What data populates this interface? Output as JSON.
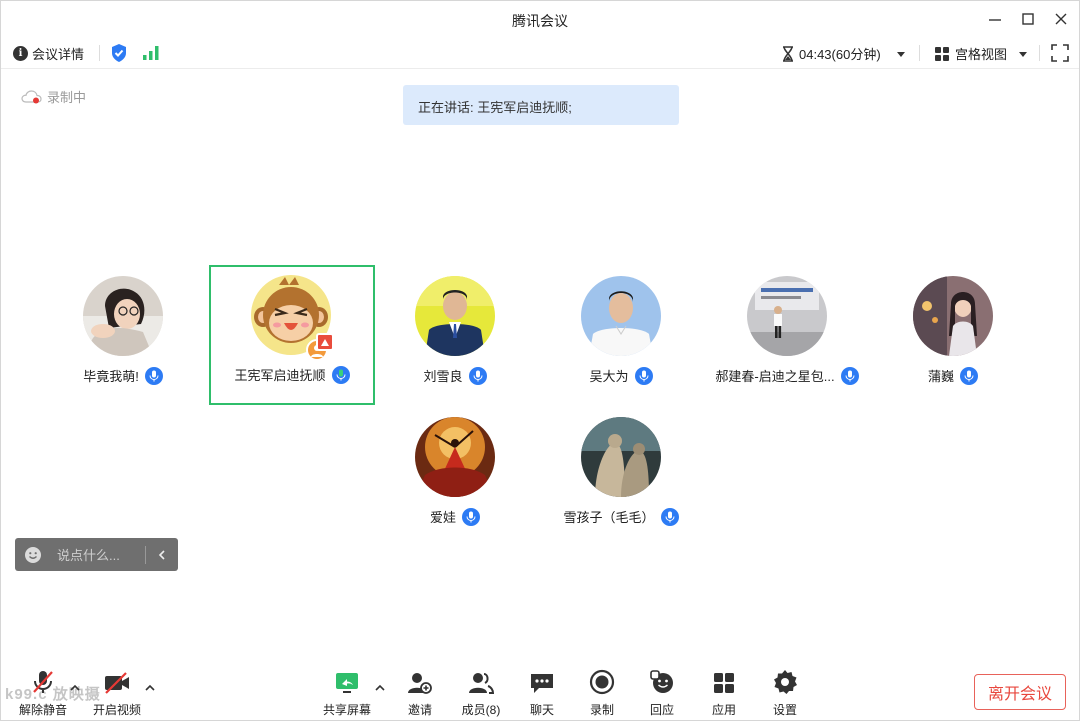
{
  "window": {
    "title": "腾讯会议"
  },
  "infobar": {
    "details_label": "会议详情",
    "timer": "04:43(60分钟)",
    "view_label": "宫格视图"
  },
  "recording": {
    "label": "录制中"
  },
  "speaking": {
    "text": "正在讲话: 王宪军启迪抚顺;"
  },
  "participants": [
    {
      "name": "毕竟我萌!",
      "avatar": "photo-woman-glasses"
    },
    {
      "name": "王宪军启迪抚顺",
      "avatar": "cartoon-monkey",
      "active": true
    },
    {
      "name": "刘雪良",
      "avatar": "photo-man-suit"
    },
    {
      "name": "吴大为",
      "avatar": "photo-man-white-shirt"
    },
    {
      "name": "郝建春-启迪之星包...",
      "avatar": "photo-man-standing"
    },
    {
      "name": "蒲巍",
      "avatar": "photo-woman-street"
    },
    {
      "name": "爱娃",
      "avatar": "painting-dancer"
    },
    {
      "name": "雪孩子（毛毛）",
      "avatar": "painting-figures"
    }
  ],
  "chat": {
    "placeholder": "说点什么..."
  },
  "toolbar": {
    "unmute": "解除静音",
    "video": "开启视频",
    "share": "共享屏幕",
    "invite": "邀请",
    "members": "成员(8)",
    "chat": "聊天",
    "record": "录制",
    "reply": "回应",
    "apps": "应用",
    "settings": "设置",
    "leave": "离开会议"
  },
  "watermark": "k99.c 放映摄",
  "colors": {
    "accent": "#2d7bf4",
    "active_border": "#2fbe6b",
    "leave": "#e8473d",
    "speaking_bg": "#dceafc"
  }
}
